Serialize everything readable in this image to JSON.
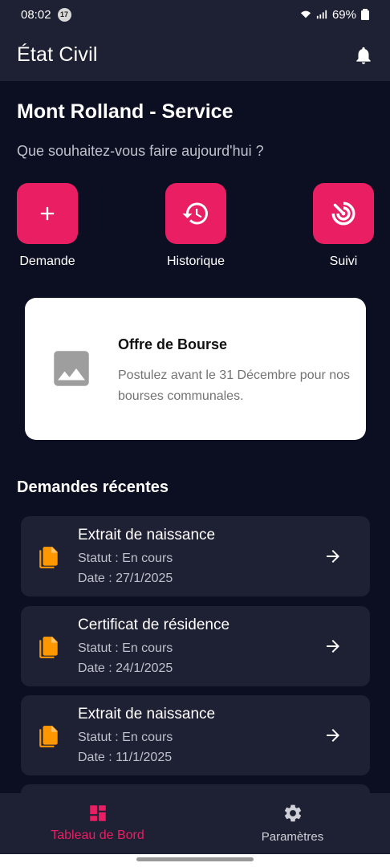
{
  "status_bar": {
    "time": "08:02",
    "notification_count": "17",
    "battery": "69%"
  },
  "appbar": {
    "title": "État Civil",
    "bell_icon": "bell-icon"
  },
  "main": {
    "heading": "Mont Rolland - Service",
    "subheading": "Que souhaitez-vous faire aujourd'hui ?"
  },
  "actions": [
    {
      "label": "Demande",
      "icon": "plus-icon"
    },
    {
      "label": "Historique",
      "icon": "history-icon"
    },
    {
      "label": "Suivi",
      "icon": "track-icon"
    }
  ],
  "promo": {
    "title": "Offre de Bourse",
    "text": "Postulez avant le 31 Décembre pour nos bourses communales.",
    "icon": "image-placeholder-icon"
  },
  "recent": {
    "title": "Demandes récentes",
    "items": [
      {
        "title": "Extrait de naissance",
        "status": "Statut : En cours",
        "date": "Date : 27/1/2025"
      },
      {
        "title": "Certificat de résidence",
        "status": "Statut : En cours",
        "date": "Date : 24/1/2025"
      },
      {
        "title": "Extrait de naissance",
        "status": "Statut : En cours",
        "date": "Date : 11/1/2025"
      }
    ]
  },
  "bottom_nav": {
    "items": [
      {
        "label": "Tableau de Bord",
        "icon": "dashboard-icon",
        "active": true
      },
      {
        "label": "Paramètres",
        "icon": "gear-icon",
        "active": false
      }
    ]
  },
  "colors": {
    "background": "#0c0f22",
    "surface": "#1e2033",
    "accent": "#e91e63",
    "document_icon": "#ff9800"
  }
}
